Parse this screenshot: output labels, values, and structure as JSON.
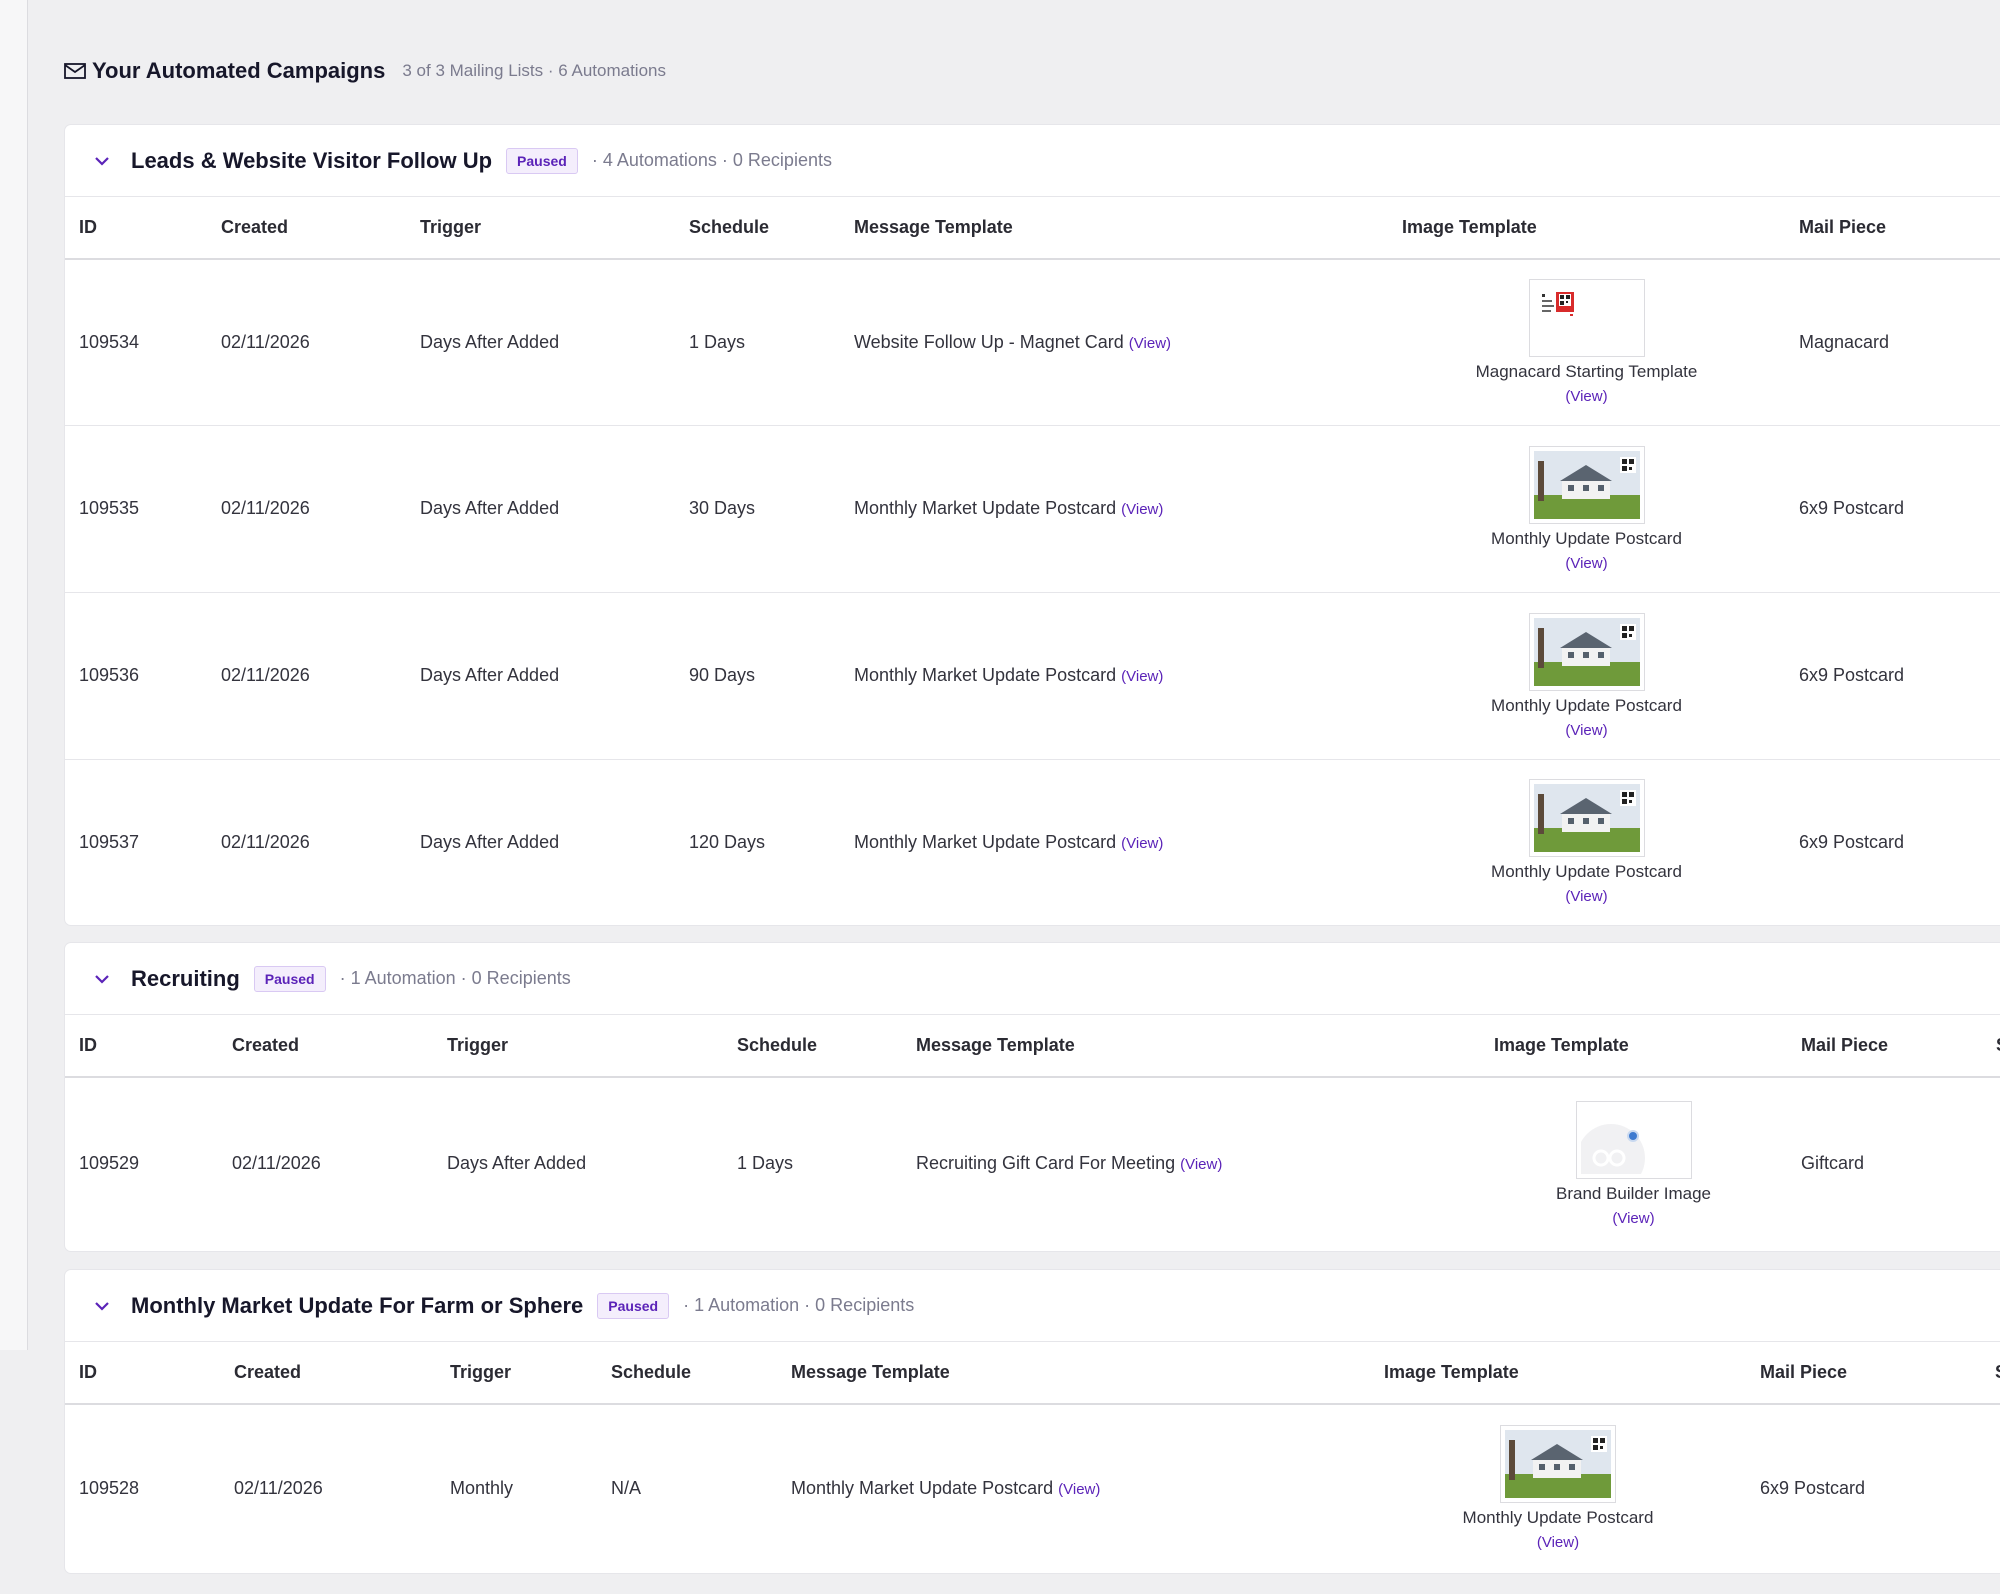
{
  "header": {
    "title": "Your Automated Campaigns",
    "meta": "3 of 3 Mailing Lists · 6 Automations",
    "icon": "mail-icon"
  },
  "colors": {
    "accent": "#5b23b8",
    "badge_bg": "#f4eefc",
    "page_bg": "#efeff1"
  },
  "lists": [
    {
      "title": "Leads & Website Visitor Follow Up",
      "status": "Paused",
      "meta": "· 4 Automations · 0 Recipients",
      "columns": [
        "ID",
        "Created",
        "Trigger",
        "Schedule",
        "Message Template",
        "Image Template",
        "Mail Piece"
      ],
      "rows": [
        {
          "id": "109534",
          "created": "02/11/2026",
          "trigger": "Days After Added",
          "schedule": "1 Days",
          "message": "Website Follow Up - Magnet Card",
          "message_view": "(View)",
          "image_name": "Magnacard Starting Template",
          "image_view": "(View)",
          "image_kind": "magnacard",
          "mail_piece": "Magnacard"
        },
        {
          "id": "109535",
          "created": "02/11/2026",
          "trigger": "Days After Added",
          "schedule": "30 Days",
          "message": "Monthly Market Update Postcard",
          "message_view": "(View)",
          "image_name": "Monthly Update Postcard",
          "image_view": "(View)",
          "image_kind": "house",
          "mail_piece": "6x9 Postcard"
        },
        {
          "id": "109536",
          "created": "02/11/2026",
          "trigger": "Days After Added",
          "schedule": "90 Days",
          "message": "Monthly Market Update Postcard",
          "message_view": "(View)",
          "image_name": "Monthly Update Postcard",
          "image_view": "(View)",
          "image_kind": "house",
          "mail_piece": "6x9 Postcard"
        },
        {
          "id": "109537",
          "created": "02/11/2026",
          "trigger": "Days After Added",
          "schedule": "120 Days",
          "message": "Monthly Market Update Postcard",
          "message_view": "(View)",
          "image_name": "Monthly Update Postcard",
          "image_view": "(View)",
          "image_kind": "house",
          "mail_piece": "6x9 Postcard"
        }
      ]
    },
    {
      "title": "Recruiting",
      "status": "Paused",
      "meta": "· 1 Automation · 0 Recipients",
      "columns": [
        "ID",
        "Created",
        "Trigger",
        "Schedule",
        "Message Template",
        "Image Template",
        "Mail Piece",
        "S"
      ],
      "rows": [
        {
          "id": "109529",
          "created": "02/11/2026",
          "trigger": "Days After Added",
          "schedule": "1 Days",
          "message": "Recruiting Gift Card For Meeting",
          "message_view": "(View)",
          "image_name": "Brand Builder Image",
          "image_view": "(View)",
          "image_kind": "brand",
          "mail_piece": "Giftcard"
        }
      ]
    },
    {
      "title": "Monthly Market Update For Farm or Sphere",
      "status": "Paused",
      "meta": "· 1 Automation · 0 Recipients",
      "columns": [
        "ID",
        "Created",
        "Trigger",
        "Schedule",
        "Message Template",
        "Image Template",
        "Mail Piece",
        "S"
      ],
      "rows": [
        {
          "id": "109528",
          "created": "02/11/2026",
          "trigger": "Monthly",
          "schedule": "N/A",
          "message": "Monthly Market Update Postcard",
          "message_view": "(View)",
          "image_name": "Monthly Update Postcard",
          "image_view": "(View)",
          "image_kind": "house",
          "mail_piece": "6x9 Postcard"
        }
      ]
    }
  ]
}
